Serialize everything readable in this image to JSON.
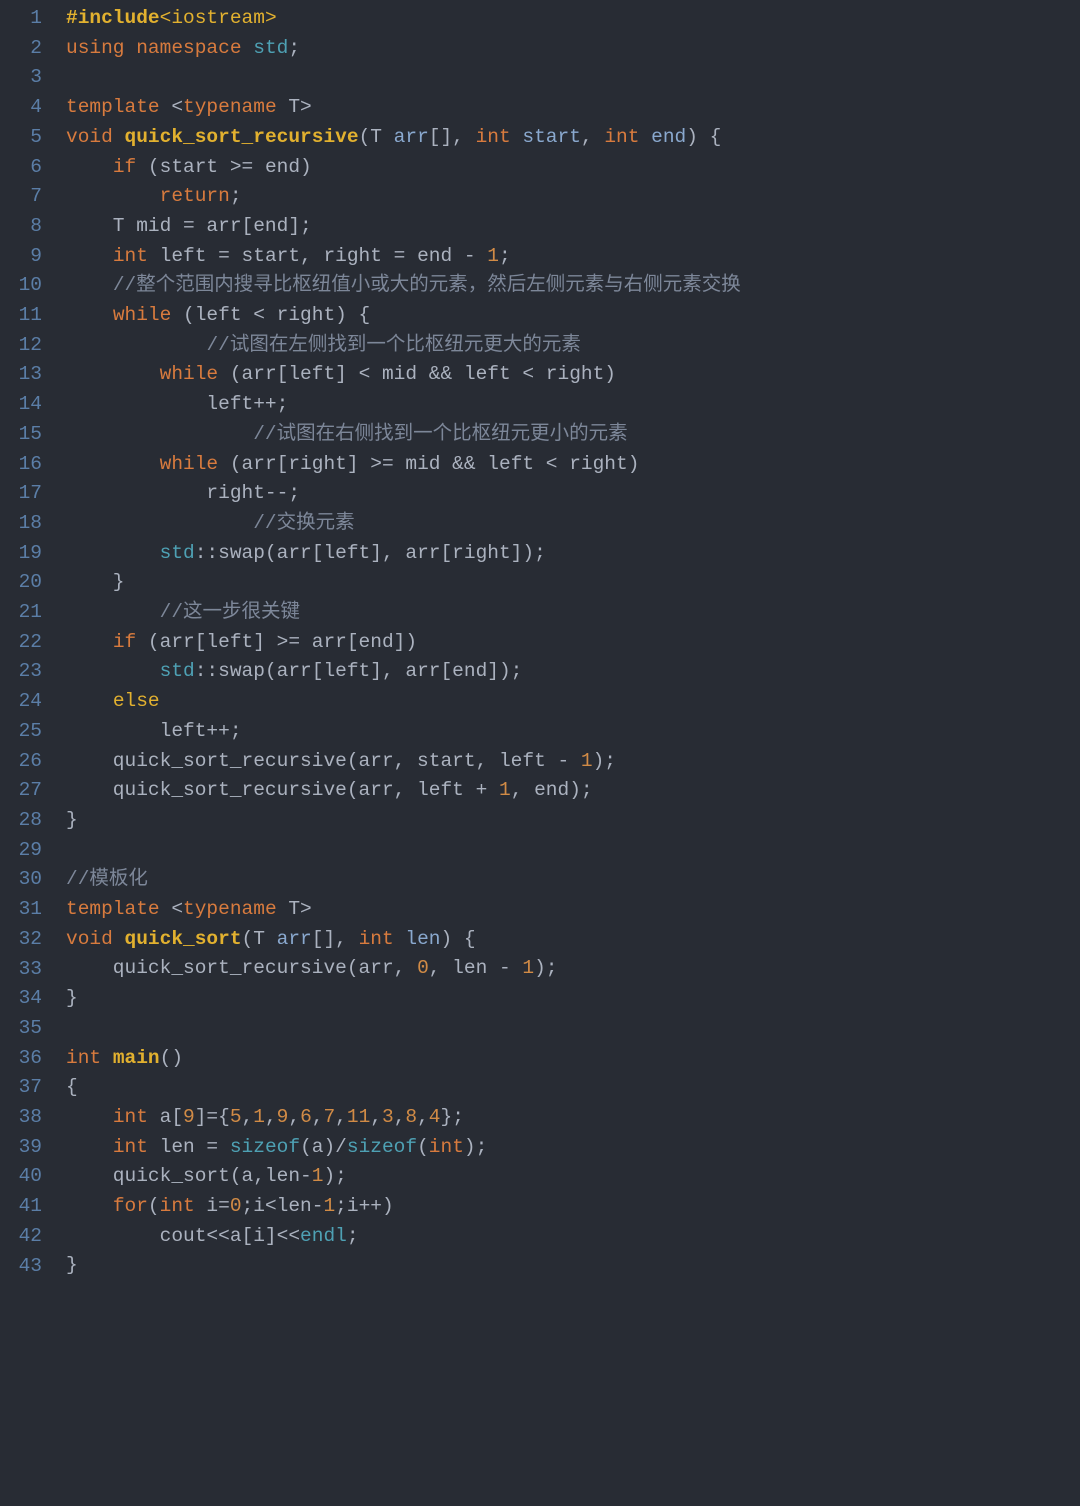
{
  "lineNumbers": [
    "1",
    "2",
    "3",
    "4",
    "5",
    "6",
    "7",
    "8",
    "9",
    "10",
    "11",
    "12",
    "13",
    "14",
    "15",
    "16",
    "17",
    "18",
    "19",
    "20",
    "21",
    "22",
    "23",
    "24",
    "25",
    "26",
    "27",
    "28",
    "29",
    "30",
    "31",
    "32",
    "33",
    "34",
    "35",
    "36",
    "37",
    "38",
    "39",
    "40",
    "41",
    "42",
    "43"
  ],
  "lines": [
    [
      [
        "tk-pp bold",
        "#include"
      ],
      [
        "tk-pp",
        "<iostream>"
      ]
    ],
    [
      [
        "tk-kw",
        "using"
      ],
      [
        "",
        ""
      ],
      [
        "tk-id",
        " "
      ],
      [
        "tk-kw",
        "namespace"
      ],
      [
        "tk-id",
        " "
      ],
      [
        "tk-std",
        "std"
      ],
      [
        "tk-id",
        ";"
      ]
    ],
    [
      [
        "",
        ""
      ]
    ],
    [
      [
        "tk-kw",
        "template"
      ],
      [
        "tk-id",
        " <"
      ],
      [
        "tk-kw",
        "typename"
      ],
      [
        "tk-id",
        " T>"
      ]
    ],
    [
      [
        "tk-kw",
        "void"
      ],
      [
        "tk-id",
        " "
      ],
      [
        "tk-fn",
        "quick_sort_recursive"
      ],
      [
        "tk-id",
        "(T "
      ],
      [
        "tk-arg",
        "arr"
      ],
      [
        "tk-id",
        "[], "
      ],
      [
        "tk-kw",
        "int"
      ],
      [
        "tk-id",
        " "
      ],
      [
        "tk-arg",
        "start"
      ],
      [
        "tk-id",
        ", "
      ],
      [
        "tk-kw",
        "int"
      ],
      [
        "tk-id",
        " "
      ],
      [
        "tk-arg",
        "end"
      ],
      [
        "tk-id",
        ") {"
      ]
    ],
    [
      [
        "tk-id",
        "    "
      ],
      [
        "tk-kw",
        "if"
      ],
      [
        "tk-id",
        " (start >= end)"
      ]
    ],
    [
      [
        "tk-id",
        "        "
      ],
      [
        "tk-kw",
        "return"
      ],
      [
        "tk-id",
        ";"
      ]
    ],
    [
      [
        "tk-id",
        "    T mid = arr[end];"
      ]
    ],
    [
      [
        "tk-id",
        "    "
      ],
      [
        "tk-kw",
        "int"
      ],
      [
        "tk-id",
        " left = start, right = end - "
      ],
      [
        "tk-num",
        "1"
      ],
      [
        "tk-id",
        ";"
      ]
    ],
    [
      [
        "tk-id",
        "    "
      ],
      [
        "tk-cmt",
        "//整个范围内搜寻比枢纽值小或大的元素，然后左侧元素与右侧元素交换"
      ]
    ],
    [
      [
        "tk-id",
        "    "
      ],
      [
        "tk-kw",
        "while"
      ],
      [
        "tk-id",
        " (left < right) {"
      ]
    ],
    [
      [
        "tk-id",
        "            "
      ],
      [
        "tk-cmt",
        "//试图在左侧找到一个比枢纽元更大的元素"
      ]
    ],
    [
      [
        "tk-id",
        "        "
      ],
      [
        "tk-kw",
        "while"
      ],
      [
        "tk-id",
        " (arr[left] < mid && left < right)"
      ]
    ],
    [
      [
        "tk-id",
        "            left++;"
      ]
    ],
    [
      [
        "tk-id",
        "                "
      ],
      [
        "tk-cmt",
        "//试图在右侧找到一个比枢纽元更小的元素"
      ]
    ],
    [
      [
        "tk-id",
        "        "
      ],
      [
        "tk-kw",
        "while"
      ],
      [
        "tk-id",
        " (arr[right] >= mid && left < right)"
      ]
    ],
    [
      [
        "tk-id",
        "            right--;"
      ]
    ],
    [
      [
        "tk-id",
        "                "
      ],
      [
        "tk-cmt",
        "//交换元素"
      ]
    ],
    [
      [
        "tk-id",
        "        "
      ],
      [
        "tk-std",
        "std"
      ],
      [
        "tk-id",
        "::swap(arr[left], arr[right]);"
      ]
    ],
    [
      [
        "tk-id",
        "    }"
      ]
    ],
    [
      [
        "tk-id",
        "        "
      ],
      [
        "tk-cmt",
        "//这一步很关键"
      ]
    ],
    [
      [
        "tk-id",
        "    "
      ],
      [
        "tk-kw",
        "if"
      ],
      [
        "tk-id",
        " (arr[left] >= arr[end])"
      ]
    ],
    [
      [
        "tk-id",
        "        "
      ],
      [
        "tk-std",
        "std"
      ],
      [
        "tk-id",
        "::swap(arr[left], arr[end]);"
      ]
    ],
    [
      [
        "tk-id",
        "    "
      ],
      [
        "tk-pp",
        "else"
      ]
    ],
    [
      [
        "tk-id",
        "        left++;"
      ]
    ],
    [
      [
        "tk-id",
        "    quick_sort_recursive(arr, start, left - "
      ],
      [
        "tk-num",
        "1"
      ],
      [
        "tk-id",
        ");"
      ]
    ],
    [
      [
        "tk-id",
        "    quick_sort_recursive(arr, left + "
      ],
      [
        "tk-num",
        "1"
      ],
      [
        "tk-id",
        ", end);"
      ]
    ],
    [
      [
        "tk-id",
        "}"
      ]
    ],
    [
      [
        "",
        ""
      ]
    ],
    [
      [
        "tk-cmt",
        "//模板化"
      ]
    ],
    [
      [
        "tk-kw",
        "template"
      ],
      [
        "tk-id",
        " <"
      ],
      [
        "tk-kw",
        "typename"
      ],
      [
        "tk-id",
        " T>"
      ]
    ],
    [
      [
        "tk-kw",
        "void"
      ],
      [
        "tk-id",
        " "
      ],
      [
        "tk-fn",
        "quick_sort"
      ],
      [
        "tk-id",
        "(T "
      ],
      [
        "tk-arg",
        "arr"
      ],
      [
        "tk-id",
        "[], "
      ],
      [
        "tk-kw",
        "int"
      ],
      [
        "tk-id",
        " "
      ],
      [
        "tk-arg",
        "len"
      ],
      [
        "tk-id",
        ") {"
      ]
    ],
    [
      [
        "tk-id",
        "    quick_sort_recursive(arr, "
      ],
      [
        "tk-num",
        "0"
      ],
      [
        "tk-id",
        ", len - "
      ],
      [
        "tk-num",
        "1"
      ],
      [
        "tk-id",
        ");"
      ]
    ],
    [
      [
        "tk-id",
        "}"
      ]
    ],
    [
      [
        "",
        ""
      ]
    ],
    [
      [
        "tk-kw",
        "int"
      ],
      [
        "tk-id",
        " "
      ],
      [
        "tk-fn",
        "main"
      ],
      [
        "tk-id",
        "()"
      ]
    ],
    [
      [
        "tk-id",
        "{"
      ]
    ],
    [
      [
        "tk-id",
        "    "
      ],
      [
        "tk-kw",
        "int"
      ],
      [
        "tk-id",
        " a["
      ],
      [
        "tk-num",
        "9"
      ],
      [
        "tk-id",
        "]={"
      ],
      [
        "tk-num",
        "5"
      ],
      [
        "tk-id",
        ","
      ],
      [
        "tk-num",
        "1"
      ],
      [
        "tk-id",
        ","
      ],
      [
        "tk-num",
        "9"
      ],
      [
        "tk-id",
        ","
      ],
      [
        "tk-num",
        "6"
      ],
      [
        "tk-id",
        ","
      ],
      [
        "tk-num",
        "7"
      ],
      [
        "tk-id",
        ","
      ],
      [
        "tk-num",
        "11"
      ],
      [
        "tk-id",
        ","
      ],
      [
        "tk-num",
        "3"
      ],
      [
        "tk-id",
        ","
      ],
      [
        "tk-num",
        "8"
      ],
      [
        "tk-id",
        ","
      ],
      [
        "tk-num",
        "4"
      ],
      [
        "tk-id",
        "};"
      ]
    ],
    [
      [
        "tk-id",
        "    "
      ],
      [
        "tk-kw",
        "int"
      ],
      [
        "tk-id",
        " len = "
      ],
      [
        "tk-std",
        "sizeof"
      ],
      [
        "tk-id",
        "(a)/"
      ],
      [
        "tk-std",
        "sizeof"
      ],
      [
        "tk-id",
        "("
      ],
      [
        "tk-kw",
        "int"
      ],
      [
        "tk-id",
        ");"
      ]
    ],
    [
      [
        "tk-id",
        "    quick_sort(a,len-"
      ],
      [
        "tk-num",
        "1"
      ],
      [
        "tk-id",
        ");"
      ]
    ],
    [
      [
        "tk-id",
        "    "
      ],
      [
        "tk-kw",
        "for"
      ],
      [
        "tk-id",
        "("
      ],
      [
        "tk-kw",
        "int"
      ],
      [
        "tk-id",
        " i="
      ],
      [
        "tk-num",
        "0"
      ],
      [
        "tk-id",
        ";i<len-"
      ],
      [
        "tk-num",
        "1"
      ],
      [
        "tk-id",
        ";i++)"
      ]
    ],
    [
      [
        "tk-id",
        "        cout<<a[i]<<"
      ],
      [
        "tk-std",
        "endl"
      ],
      [
        "tk-id",
        ";"
      ]
    ],
    [
      [
        "tk-id",
        "}"
      ]
    ]
  ]
}
